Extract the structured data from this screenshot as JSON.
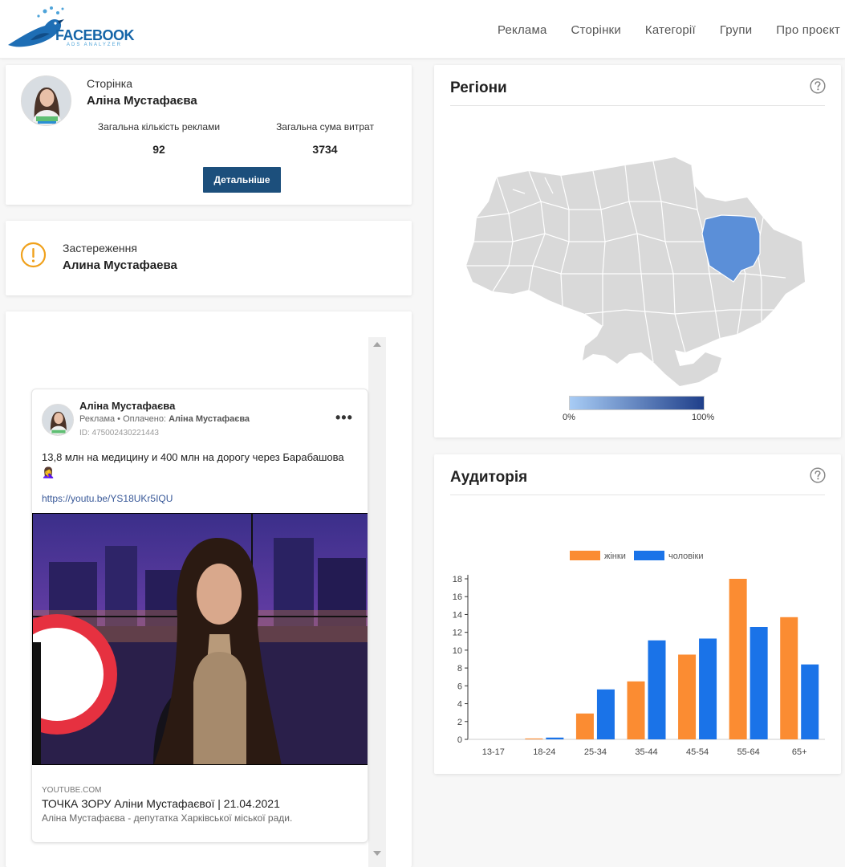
{
  "header": {
    "logo_text": "FACEBOOK",
    "logo_sub": "ADS ANALYZER",
    "nav": [
      "Реклама",
      "Сторінки",
      "Категорії",
      "Групи",
      "Про проєкт"
    ]
  },
  "page_card": {
    "label": "Сторінка",
    "name": "Аліна Мустафаєва",
    "stats": [
      {
        "label": "Загальна кількість реклами",
        "value": "92"
      },
      {
        "label": "Загальна сума витрат",
        "value": "3734"
      }
    ],
    "details_label": "Детальніше"
  },
  "warning_card": {
    "label": "Застереження",
    "name": "Алина Мустафаева"
  },
  "ad_post": {
    "author": "Аліна Мустафаєва",
    "meta_prefix": "Реклама • Оплачено: ",
    "meta_payer": "Аліна Мустафаєва",
    "id_text": "ID: 475002430221443",
    "text": "13,8 млн на медицину и 400 млн на дорогу через Барабашова 🤦‍♀️",
    "link": "https://youtu.be/YS18UKr5IQU",
    "source": "YOUTUBE.COM",
    "title": "ТОЧКА ЗОРУ Аліни Мустафаєвої | 21.04.2021",
    "description": "Аліна Мустафаєва - депутатка Харківської міської ради."
  },
  "regions_card": {
    "title": "Регіони",
    "legend_min": "0%",
    "legend_max": "100%",
    "highlight_color": "#5b8fd8",
    "base_color": "#d9d9d9"
  },
  "audience_card": {
    "title": "Аудиторія"
  },
  "chart_data": {
    "type": "bar",
    "categories": [
      "13-17",
      "18-24",
      "25-34",
      "35-44",
      "45-54",
      "55-64",
      "65+"
    ],
    "series": [
      {
        "name": "жінки",
        "color": "#fb8c32",
        "values": [
          0,
          0.1,
          2.9,
          6.5,
          9.5,
          18,
          13.7
        ]
      },
      {
        "name": "чоловіки",
        "color": "#1a73e8",
        "values": [
          0,
          0.2,
          5.6,
          11.1,
          11.3,
          12.6,
          8.4
        ]
      }
    ],
    "yticks": [
      0,
      2,
      4,
      6,
      8,
      10,
      12,
      14,
      16,
      18
    ],
    "ylim": [
      0,
      18
    ],
    "legend_position": "top-center"
  }
}
